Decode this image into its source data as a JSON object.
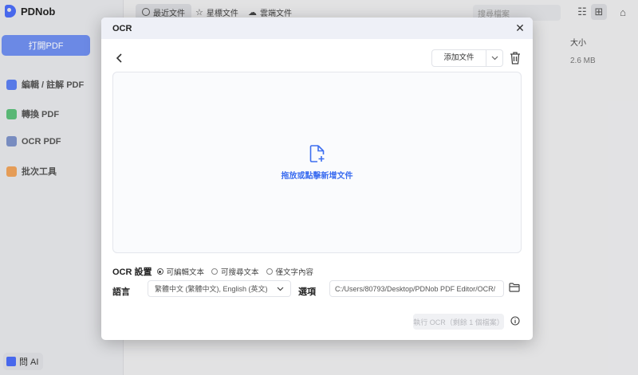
{
  "app": {
    "name": "PDNob",
    "open_pdf": "打開PDF",
    "nav": [
      {
        "label": "編輯 / 註解 PDF",
        "icon": "edit-icon"
      },
      {
        "label": "轉換 PDF",
        "icon": "convert-icon"
      },
      {
        "label": "OCR PDF",
        "icon": "ocr-icon"
      },
      {
        "label": "批次工具",
        "icon": "batch-icon"
      }
    ],
    "ask_ai": "問 AI",
    "tabs": [
      {
        "label": "最近文件",
        "icon": "clock-icon"
      },
      {
        "label": "星標文件",
        "icon": "star-icon"
      },
      {
        "label": "雲端文件",
        "icon": "cloud-icon"
      }
    ],
    "search_placeholder": "搜尋檔案",
    "size_header": "大小",
    "size_value": "2.6 MB"
  },
  "modal": {
    "title": "OCR",
    "add_file": "添加文件",
    "drop_text": "拖放或點擊新增文件",
    "settings_label": "OCR 設置",
    "options": [
      "可編輯文本",
      "可搜尋文本",
      "僅文字內容"
    ],
    "selected_option": 0,
    "language_label": "語言",
    "language_value": "繁體中文 (繁體中文), English (英文)",
    "output_label": "選項",
    "output_path": "C:/Users/80793/Desktop/PDNob PDF Editor/OCR/",
    "run_button": "執行 OCR（剩餘 1 個檔案）"
  },
  "colors": {
    "accent": "#3d6ef0",
    "open_pdf_bg": "#6f8ff0",
    "header_bg": "#eef0f7"
  }
}
